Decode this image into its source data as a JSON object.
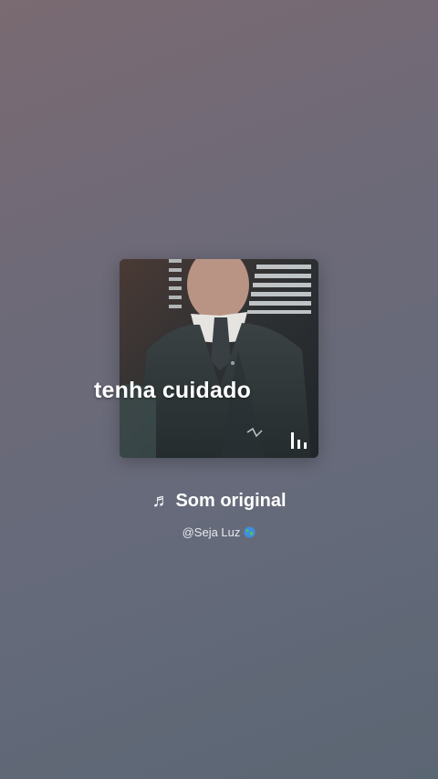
{
  "cover": {
    "overlay_text": "tenha cuidado",
    "icon": "audio-bars-icon"
  },
  "sound": {
    "icon": "music-note-icon",
    "note_glyph": "♬",
    "title": "Som original",
    "author": "@Seja Luz",
    "author_icon": "globe-icon"
  },
  "colors": {
    "text": "#ffffff",
    "subtext": "#e8e8ee"
  }
}
